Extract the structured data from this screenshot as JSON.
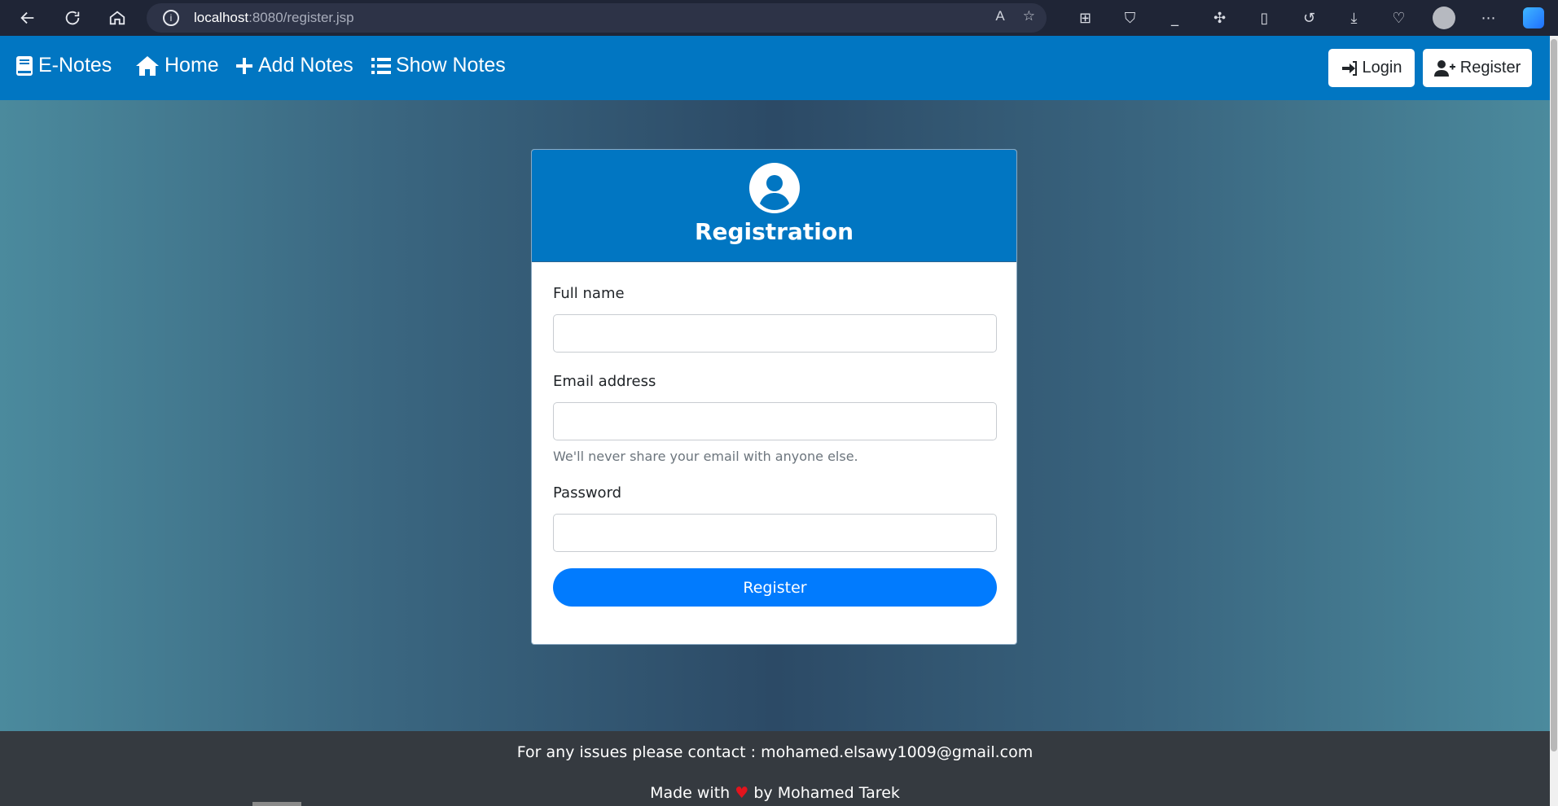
{
  "browser": {
    "url_host": "localhost",
    "url_rest": ":8080/register.jsp"
  },
  "navbar": {
    "brand": "E-Notes",
    "links": [
      {
        "label": "Home"
      },
      {
        "label": "Add Notes"
      },
      {
        "label": "Show Notes"
      }
    ],
    "login_label": "Login",
    "register_label": "Register"
  },
  "card": {
    "title": "Registration",
    "fields": {
      "fullname_label": "Full name",
      "email_label": "Email address",
      "email_help": "We'll never share your email with anyone else.",
      "password_label": "Password"
    },
    "submit_label": "Register"
  },
  "footer": {
    "contact_text": "For any issues please contact : mohamed.elsawy1009@gmail.com",
    "made_with": "Made with",
    "by": "by Mohamed Tarek"
  },
  "colors": {
    "navbar": "#0176c2",
    "primary_button": "#017bfe",
    "footer": "#353a40"
  }
}
